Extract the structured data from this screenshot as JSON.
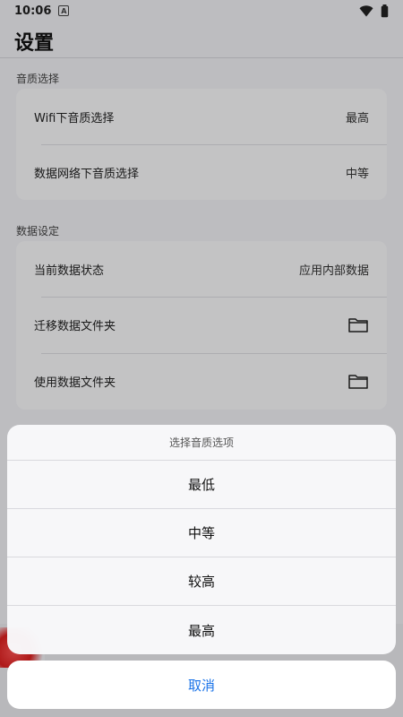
{
  "status_bar": {
    "time": "10:06",
    "app_icon_letter": "A"
  },
  "page": {
    "title": "设置"
  },
  "sections": {
    "audio": {
      "label": "音质选择",
      "rows": [
        {
          "label": "Wifi下音质选择",
          "value": "最高"
        },
        {
          "label": "数据网络下音质选择",
          "value": "中等"
        }
      ]
    },
    "data": {
      "label": "数据设定",
      "rows": [
        {
          "label": "当前数据状态",
          "value": "应用内部数据"
        },
        {
          "label": "迁移数据文件夹",
          "icon": "folder-icon"
        },
        {
          "label": "使用数据文件夹",
          "icon": "folder-icon"
        }
      ]
    }
  },
  "sheet": {
    "title": "选择音质选项",
    "options": [
      "最低",
      "中等",
      "较高",
      "最高"
    ],
    "cancel": "取消"
  },
  "colors": {
    "accent": "#1a73e8",
    "background": "#f2f2f7"
  }
}
